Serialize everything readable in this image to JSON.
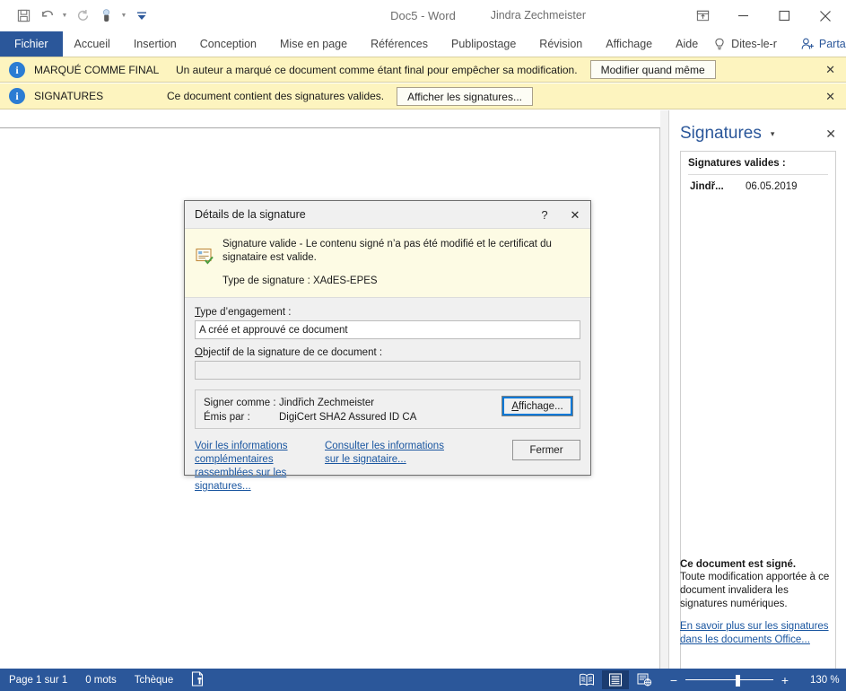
{
  "window": {
    "title": "Doc5  -  Word",
    "account_name": "Jindra Zechmeister",
    "quick_access": [
      {
        "name": "save-icon",
        "label": "Enregistrer"
      },
      {
        "name": "undo-icon",
        "label": "Annuler"
      },
      {
        "name": "redo-icon",
        "label": "Rétablir"
      },
      {
        "name": "touch-mode-icon",
        "label": "Mode tactile/souris"
      },
      {
        "name": "customize-qat-icon",
        "label": "Personnaliser la barre d'outils Accès rapide"
      }
    ],
    "controls": {
      "ribbon_display": "Options d'affichage du ruban",
      "minimize": "Réduire",
      "maximize": "Agrandir",
      "close": "Fermer"
    }
  },
  "ribbon": {
    "tabs": [
      {
        "label": "Fichier",
        "active": true
      },
      {
        "label": "Accueil",
        "active": false
      },
      {
        "label": "Insertion",
        "active": false
      },
      {
        "label": "Conception",
        "active": false
      },
      {
        "label": "Mise en page",
        "active": false
      },
      {
        "label": "Références",
        "active": false
      },
      {
        "label": "Publipostage",
        "active": false
      },
      {
        "label": "Révision",
        "active": false
      },
      {
        "label": "Affichage",
        "active": false
      },
      {
        "label": "Aide",
        "active": false
      }
    ],
    "tell_me": "Dites-le-r",
    "share": "Partager"
  },
  "message_bars": [
    {
      "icon": "info-icon",
      "label": "MARQUÉ COMME FINAL",
      "text": "Un auteur a marqué ce document comme étant final pour empêcher sa modification.",
      "button": "Modifier quand même",
      "close": "✕"
    },
    {
      "icon": "info-icon",
      "label": "SIGNATURES",
      "text": "Ce document contient des signatures valides.",
      "button": "Afficher les signatures...",
      "close": "✕"
    }
  ],
  "task_pane": {
    "title": "Signatures",
    "caret": "▾",
    "close": "✕",
    "list_header": "Signatures valides :",
    "signatures": [
      {
        "name": "Jindř...",
        "date": "06.05.2019"
      }
    ],
    "footer_title": "Ce document est signé.",
    "footer_text": "Toute modification apportée à ce document invalidera les signatures numériques.",
    "footer_link": "En savoir plus sur les signatures dans les documents Office..."
  },
  "dialog": {
    "title": "Détails de la signature",
    "help": "?",
    "close": "✕",
    "banner": {
      "icon": "signature-valid-icon",
      "status": "Signature valide - Le contenu signé n’a pas été modifié et le certificat du signataire est valide.",
      "signature_type": "Type de signature : XAdES-EPES"
    },
    "commitment_label": "Type d’engagement :",
    "commitment_value": "A créé et approuvé ce document",
    "purpose_label": "Objectif de la signature de ce document :",
    "purpose_value": "",
    "signer_key": "Signer comme :",
    "signer_value": "Jindřich Zechmeister",
    "issuer_key": "Émis par :",
    "issuer_value": "DigiCert SHA2 Assured ID CA",
    "view_button": "Affichage...",
    "link_more_info": "Voir les informations complémentaires rassemblées sur les signatures...",
    "link_signer_info": "Consulter les informations sur le signataire...",
    "close_button": "Fermer"
  },
  "status_bar": {
    "page": "Page 1 sur 1",
    "words": "0 mots",
    "language": "Tchèque",
    "signature_icon": "document-signed-icon",
    "views": [
      {
        "name": "read-mode-icon",
        "label": "Mode Lecture",
        "active": false
      },
      {
        "name": "print-layout-icon",
        "label": "Page",
        "active": true
      },
      {
        "name": "web-layout-icon",
        "label": "Web",
        "active": false
      }
    ],
    "zoom_out": "−",
    "zoom_in": "+",
    "zoom_level": "130 %"
  },
  "colors": {
    "word_blue": "#2b579a",
    "message_bar": "#fdf4bf",
    "link": "#1a56a0",
    "focus": "#0078d7"
  }
}
